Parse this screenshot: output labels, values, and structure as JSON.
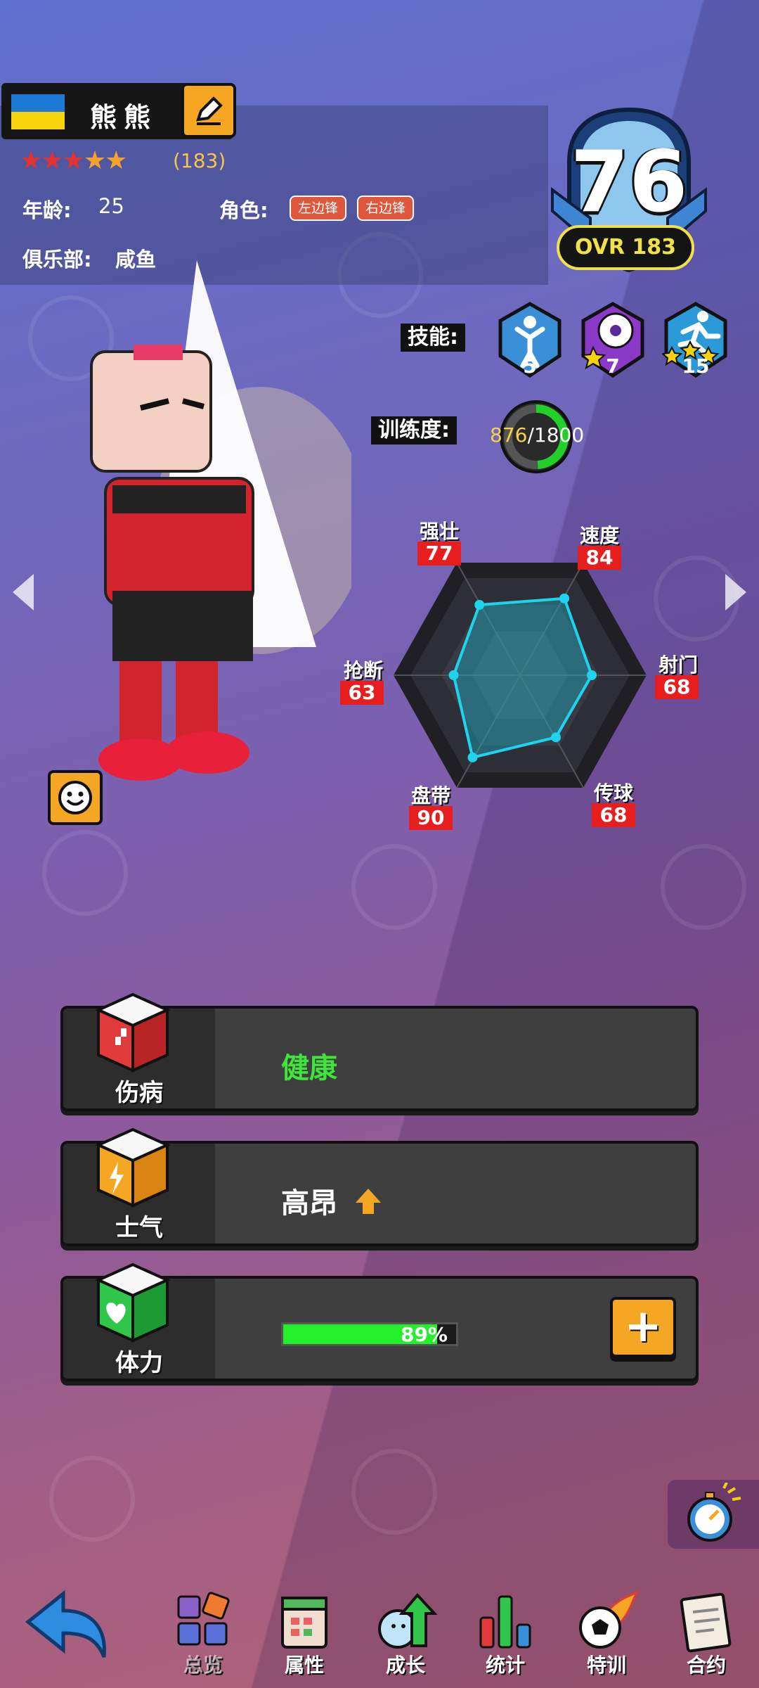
{
  "player": {
    "name": "熊熊",
    "stars_count": "(183)",
    "age_label": "年龄:",
    "age_value": "25",
    "role_label": "角色:",
    "roles": [
      "左边锋",
      "右边锋"
    ],
    "club_label": "俱乐部:",
    "club_value": "咸鱼",
    "star_rating": 5
  },
  "rating": {
    "overall": "76",
    "ovr_pill": "OVR 183"
  },
  "skills": {
    "label": "技能:",
    "items": [
      {
        "icon": "jump-skill-icon",
        "value": "5"
      },
      {
        "icon": "ball-skill-icon",
        "value": "7"
      },
      {
        "icon": "run-skill-icon",
        "value": "15"
      }
    ]
  },
  "training": {
    "label": "训练度:",
    "current": "876",
    "total": "/1800",
    "progress": 0.49
  },
  "stats": {
    "strength": {
      "name": "强壮",
      "value": "77"
    },
    "speed": {
      "name": "速度",
      "value": "84"
    },
    "shooting": {
      "name": "射门",
      "value": "68"
    },
    "passing": {
      "name": "传球",
      "value": "68"
    },
    "dribbling": {
      "name": "盘带",
      "value": "90"
    },
    "tackling": {
      "name": "抢断",
      "value": "63"
    }
  },
  "status": {
    "injury": {
      "label": "伤病",
      "value": "健康"
    },
    "morale": {
      "label": "士气",
      "value": "高昂"
    },
    "stamina": {
      "label": "体力",
      "value": "89%",
      "level": 0.89
    }
  },
  "nav": [
    {
      "label": "总览",
      "icon": "overview-icon"
    },
    {
      "label": "属性",
      "icon": "attributes-icon"
    },
    {
      "label": "成长",
      "icon": "growth-icon"
    },
    {
      "label": "统计",
      "icon": "stats-icon"
    },
    {
      "label": "特训",
      "icon": "special-training-icon"
    },
    {
      "label": "合约",
      "icon": "contract-icon"
    }
  ],
  "colors": {
    "accent": "#f5a623",
    "stat_badge": "#e81d1d",
    "health_green": "#3fe63a",
    "ovr_gold": "#f0e14a"
  }
}
